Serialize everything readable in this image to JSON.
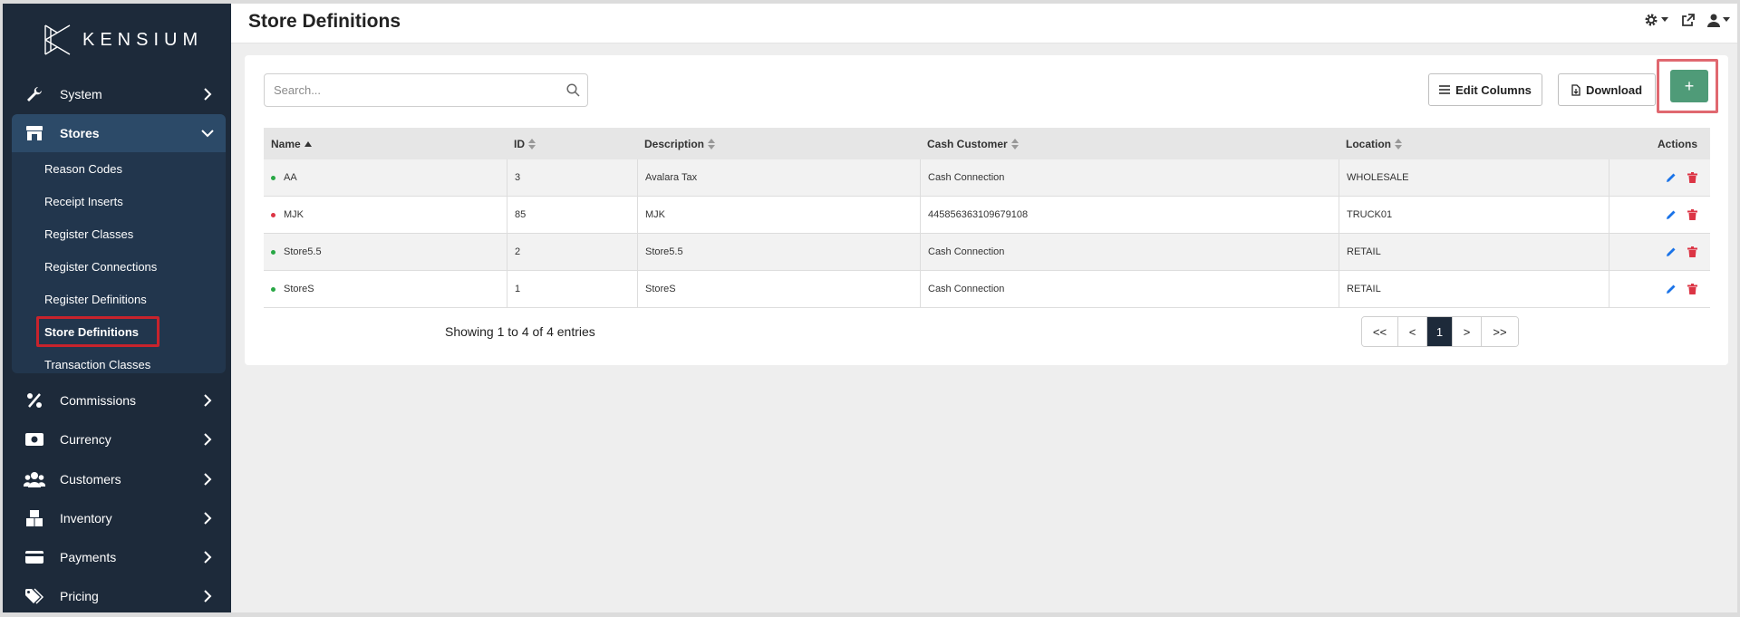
{
  "brand": {
    "name": "KENSIUM"
  },
  "header": {
    "title": "Store Definitions"
  },
  "sidebar": {
    "items": [
      {
        "label": "System",
        "icon": "wrench-icon"
      },
      {
        "label": "Stores",
        "icon": "store-icon",
        "expanded": true
      },
      {
        "label": "Commissions",
        "icon": "percent-icon"
      },
      {
        "label": "Currency",
        "icon": "money-icon"
      },
      {
        "label": "Customers",
        "icon": "users-icon"
      },
      {
        "label": "Inventory",
        "icon": "boxes-icon"
      },
      {
        "label": "Payments",
        "icon": "credit-card-icon"
      },
      {
        "label": "Pricing",
        "icon": "tags-icon"
      }
    ],
    "stores_submenu": [
      "Reason Codes",
      "Receipt Inserts",
      "Register Classes",
      "Register Connections",
      "Register Definitions",
      "Store Definitions",
      "Transaction Classes"
    ]
  },
  "toolbar": {
    "search_placeholder": "Search...",
    "edit_columns_label": "Edit Columns",
    "download_label": "Download",
    "add_label": "+"
  },
  "table": {
    "columns": [
      "Name",
      "ID",
      "Description",
      "Cash Customer",
      "Location",
      "Actions"
    ],
    "rows": [
      {
        "name": "AA",
        "id": "3",
        "description": "Avalara Tax",
        "cash_customer": "Cash Connection",
        "location": "WHOLESALE",
        "status_color": "#28a745"
      },
      {
        "name": "MJK",
        "id": "85",
        "description": "MJK",
        "cash_customer": "445856363109679108",
        "location": "TRUCK01",
        "status_color": "#dc3545"
      },
      {
        "name": "Store5.5",
        "id": "2",
        "description": "Store5.5",
        "cash_customer": "Cash Connection",
        "location": "RETAIL",
        "status_color": "#28a745"
      },
      {
        "name": "StoreS",
        "id": "1",
        "description": "StoreS",
        "cash_customer": "Cash Connection",
        "location": "RETAIL",
        "status_color": "#28a745"
      }
    ]
  },
  "footer": {
    "showing_text": "Showing 1 to 4 of 4 entries",
    "pager": [
      "<<",
      "<",
      "1",
      ">",
      ">>"
    ],
    "current_page": "1"
  },
  "colors": {
    "sidebar_bg": "#1d2a3a",
    "accent_green": "#4f9b78",
    "highlight_red": "#c8232c",
    "edit_blue": "#1a73e8",
    "delete_red": "#dc3545"
  }
}
